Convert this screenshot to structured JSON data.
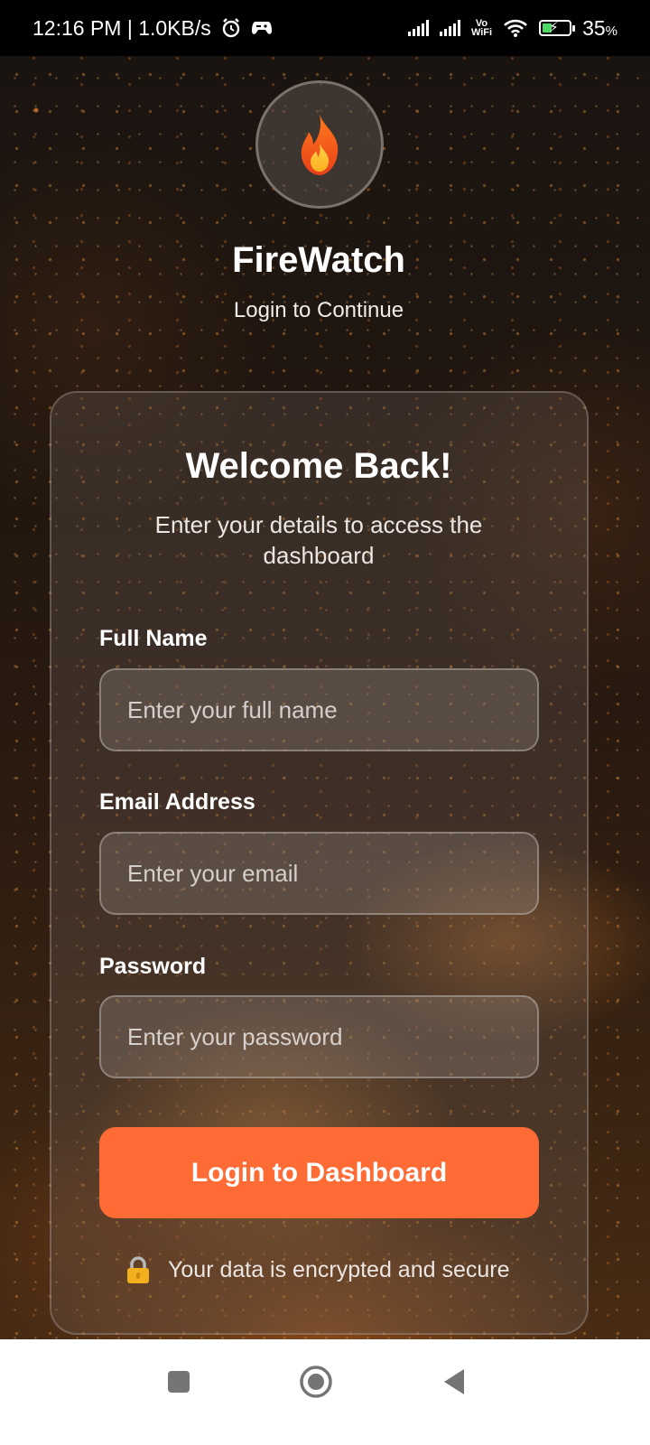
{
  "status_bar": {
    "time_and_speed": "12:16 PM | 1.0KB/s",
    "vowifi_line1": "Vo",
    "vowifi_line2": "WiFi",
    "battery": "35",
    "battery_unit": "%"
  },
  "header": {
    "app_title": "FireWatch",
    "subtitle": "Login to Continue",
    "logo_icon": "fire-icon"
  },
  "login_card": {
    "title": "Welcome Back!",
    "subtitle": "Enter your details to access the dashboard",
    "fields": [
      {
        "label": "Full Name",
        "placeholder": "Enter your full name",
        "value": ""
      },
      {
        "label": "Email Address",
        "placeholder": "Enter your email",
        "value": ""
      },
      {
        "label": "Password",
        "placeholder": "Enter your password",
        "value": ""
      }
    ],
    "login_button_label": "Login to Dashboard",
    "secure_note": "Your data is encrypted and secure",
    "secure_icon": "lock-icon"
  },
  "nav_bar": {
    "buttons": [
      "recents-icon",
      "home-icon",
      "back-icon"
    ]
  },
  "colors": {
    "accent": "#ff6b35",
    "nav_bar": "#ffffff",
    "status_bar": "#000000"
  }
}
